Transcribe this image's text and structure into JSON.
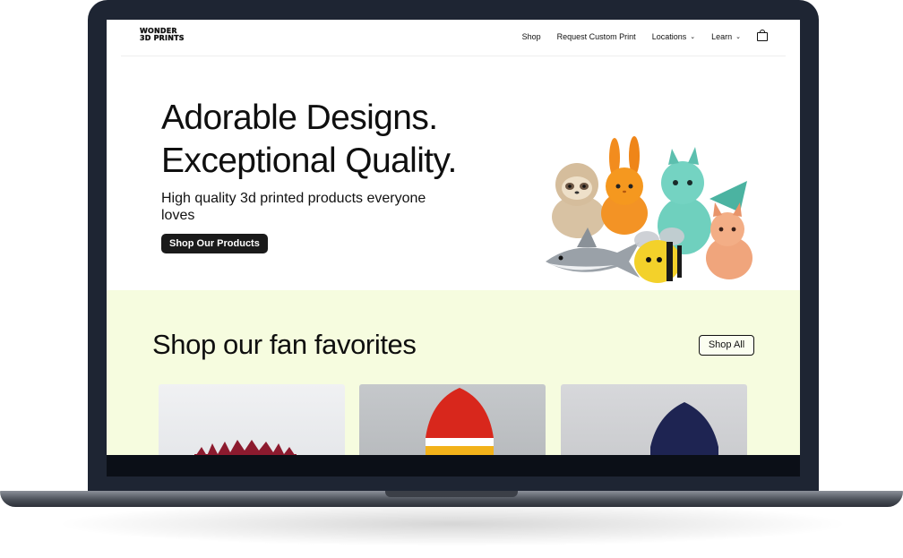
{
  "brand": {
    "logo_line1": "WONDER",
    "logo_line2": "3D PRINTS"
  },
  "nav": {
    "items": [
      {
        "label": "Shop"
      },
      {
        "label": "Request Custom Print"
      },
      {
        "label": "Locations",
        "dropdown": true
      },
      {
        "label": "Learn",
        "dropdown": true
      }
    ],
    "cart_icon": "shopping-bag-icon"
  },
  "hero": {
    "title_line1": "Adorable Designs.",
    "title_line2": "Exceptional Quality.",
    "subtitle": "High quality 3d printed products everyone loves",
    "cta": "Shop Our Products",
    "image_subjects": [
      "sloth",
      "rabbit",
      "dragon",
      "shark",
      "bee",
      "small dragon"
    ]
  },
  "favorites": {
    "title": "Shop our fan favorites",
    "shop_all": "Shop All",
    "products": [
      {
        "image": "red spiky flower print"
      },
      {
        "image": "red and yellow rocket print"
      },
      {
        "image": "navy blue rocket print"
      }
    ]
  },
  "colors": {
    "laptop_frame": "#1e2533",
    "favorites_bg": "#f6fcdf",
    "button_dark": "#1a1a1a",
    "text": "#0f0f0f"
  }
}
